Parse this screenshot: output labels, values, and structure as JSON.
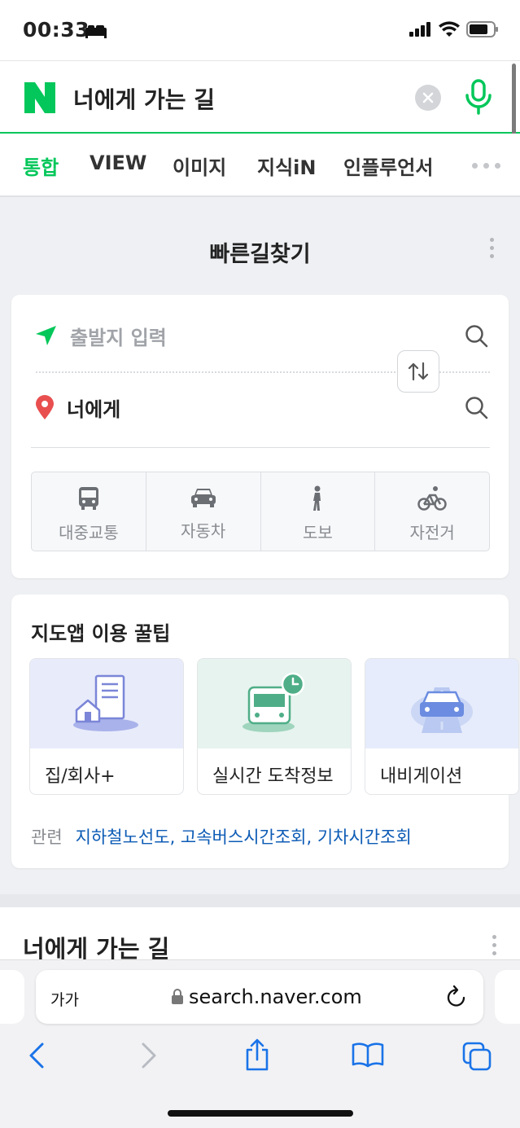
{
  "status_bar": {
    "time": "00:33"
  },
  "search": {
    "query": "너에게 가는 길"
  },
  "tabs": [
    "통합",
    "VIEW",
    "이미지",
    "지식iN",
    "인플루언서"
  ],
  "route_finder": {
    "title": "빠른길찾기",
    "origin_placeholder": "출발지 입력",
    "destination": "너에게",
    "modes": [
      "대중교통",
      "자동차",
      "도보",
      "자전거"
    ]
  },
  "map_tips": {
    "title": "지도앱 이용 꿀팁",
    "cards": [
      "집/회사+",
      "실시간 도착정보",
      "내비게이션"
    ],
    "related_label": "관련",
    "related_links": [
      "지하철노선도",
      "고속버스시간조회",
      "기차시간조회"
    ]
  },
  "result_section": {
    "title": "너에게 가는 길"
  },
  "browser": {
    "text_size_label": "가가",
    "url": "search.naver.com"
  },
  "colors": {
    "naver_green": "#03c75a",
    "link_blue": "#0c5bb5",
    "pin_red": "#e94f4f"
  }
}
